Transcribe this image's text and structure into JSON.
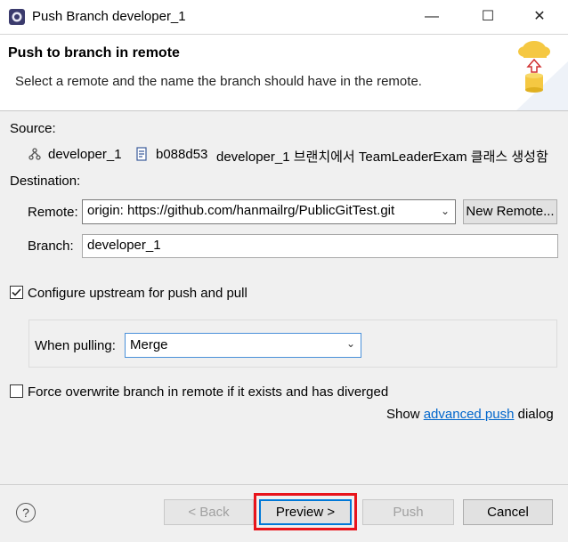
{
  "window": {
    "title": "Push Branch developer_1",
    "minimize": "—",
    "maximize": "☐",
    "close": "✕"
  },
  "banner": {
    "title": "Push to branch in remote",
    "subtitle": "Select a remote and the name the branch should have in the remote."
  },
  "source": {
    "label": "Source:",
    "branch": "developer_1",
    "commit_id": "b088d53",
    "commit_message": "developer_1 브랜치에서 TeamLeaderExam 클래스 생성함"
  },
  "destination": {
    "label": "Destination:",
    "remote_label": "Remote:",
    "remote_value": "origin: https://github.com/hanmailrg/PublicGitTest.git",
    "new_remote_button": "New Remote...",
    "branch_label": "Branch:",
    "branch_value": "developer_1"
  },
  "upstream": {
    "label": "Configure upstream for push and pull",
    "checked": true,
    "when_pulling_label": "When pulling:",
    "when_pulling_value": "Merge"
  },
  "force": {
    "label": "Force overwrite branch in remote if it exists and has diverged",
    "checked": false
  },
  "advanced": {
    "prefix": "Show",
    "link": "advanced push",
    "suffix": "dialog"
  },
  "buttons": {
    "back": "< Back",
    "preview": "Preview >",
    "push": "Push",
    "cancel": "Cancel",
    "help": "?"
  },
  "colors": {
    "accent": "#0078d7",
    "highlight": "#e8141b",
    "link": "#0066cc"
  }
}
